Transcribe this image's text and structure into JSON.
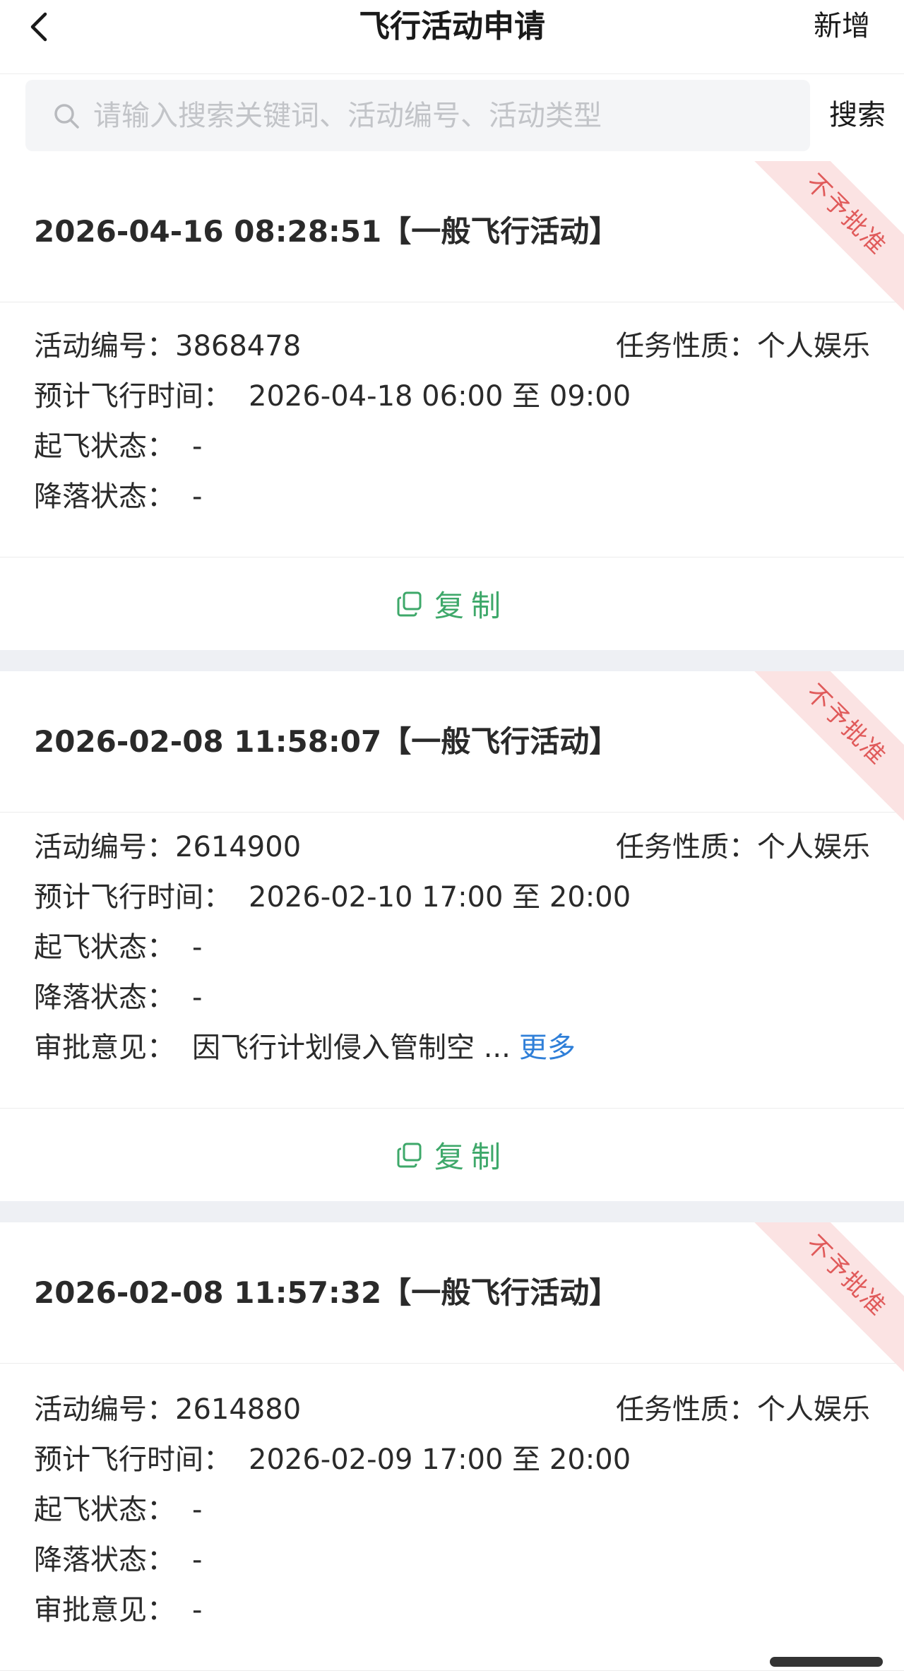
{
  "nav": {
    "title": "飞行活动申请",
    "add_label": "新增"
  },
  "search": {
    "placeholder": "请输入搜索关键词、活动编号、活动类型",
    "button_label": "搜索"
  },
  "labels": {
    "activity_no": "活动编号：",
    "task_nature": "任务性质：",
    "planned_time": "预计飞行时间：",
    "takeoff_status": "起飞状态：",
    "landing_status": "降落状态：",
    "approval_opinion": "审批意见：",
    "copy": "复制",
    "more": "更多"
  },
  "cards": [
    {
      "title": "2026-04-16 08:28:51【一般飞行活动】",
      "badge": "不予批准",
      "activity_no": "3868478",
      "task_nature": "个人娱乐",
      "planned_time": "2026-04-18 06:00 至 09:00",
      "takeoff_status": "-",
      "landing_status": "-"
    },
    {
      "title": "2026-02-08 11:58:07【一般飞行活动】",
      "badge": "不予批准",
      "activity_no": "2614900",
      "task_nature": "个人娱乐",
      "planned_time": "2026-02-10 17:00 至 20:00",
      "takeoff_status": "-",
      "landing_status": "-",
      "approval_opinion": "因飞行计划侵入管制空 ..."
    },
    {
      "title": "2026-02-08 11:57:32【一般飞行活动】",
      "badge": "不予批准",
      "activity_no": "2614880",
      "task_nature": "个人娱乐",
      "planned_time": "2026-02-09 17:00 至 20:00",
      "takeoff_status": "-",
      "landing_status": "-",
      "approval_opinion": "-"
    }
  ],
  "colors": {
    "accent_green": "#3ea86a",
    "link_blue": "#2f7fd8",
    "reject_red": "#e05a5a",
    "reject_bg": "#fbe3e3",
    "divider_gray": "#eef0f4"
  }
}
